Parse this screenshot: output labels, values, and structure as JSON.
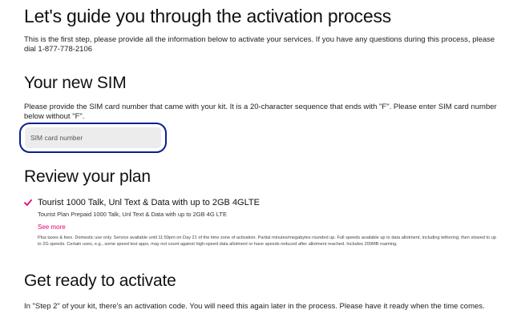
{
  "activation": {
    "title": "Let's guide you through the activation process",
    "intro": "This is the first step, please provide all the information below to activate your services. If you have any questions during this process, please dial 1-877-778-2106"
  },
  "sim": {
    "title": "Your new SIM",
    "description": "Please provide the SIM card number that came with your kit. It is a 20-character sequence that ends with \"F\". Please enter SIM card number below without \"F\".",
    "placeholder": "SIM card number",
    "value": ""
  },
  "plan": {
    "title": "Review your plan",
    "name": "Tourist 1000 Talk, Unl Text & Data with up to 2GB 4GLTE",
    "subtitle": "Tourist Plan Prepaid 1000 Talk, Unl Text & Data with up to 2GB 4G LTE",
    "see_more": "See more",
    "fineprint": "Plus taxes & fees. Domestic use only. Service available until 11:59pm on Day 21 of the time zone of activation. Partial minutes/megabytes rounded up. Full speeds available up to data allotment, including tethering; then slowed to up to 2G speeds. Certain uses, e.g., some speed test apps, may not count against high-speed data allotment or have speeds reduced after allotment reached. Includes 200MB roaming.",
    "check_icon": "checkmark-icon",
    "accent_color": "#e20074"
  },
  "ready": {
    "title": "Get ready to activate",
    "description": "In \"Step 2\" of your kit, there's an activation code. You will need this again later in the process. Please have it ready when the time comes."
  }
}
